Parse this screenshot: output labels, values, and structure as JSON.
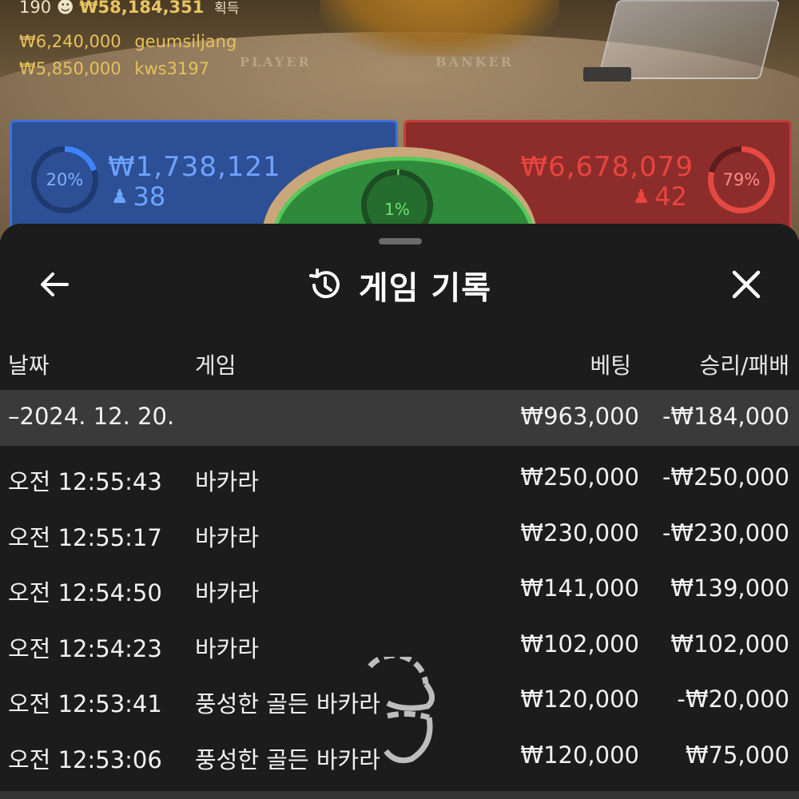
{
  "hud": {
    "top_count": "190",
    "top_amount": "₩58,184,351",
    "top_suffix": "획득",
    "winners": [
      {
        "amount": "₩6,240,000",
        "user": "geumsiljang"
      },
      {
        "amount": "₩5,850,000",
        "user": "kws3197"
      }
    ]
  },
  "table": {
    "player_label": "PLAYER",
    "banker_label": "BANKER"
  },
  "bets": {
    "player": {
      "percent": "20%",
      "amount": "₩1,738,121",
      "count": "38",
      "color": "#3e73d8"
    },
    "banker": {
      "percent": "79%",
      "amount": "₩6,678,079",
      "count": "42",
      "color": "#c3403a"
    },
    "tie": {
      "percent": "1%",
      "color": "#57c95c"
    }
  },
  "sheet": {
    "title": "게임 기록",
    "back_icon": "arrow-left-icon",
    "history_icon": "history-icon",
    "close_icon": "close-icon",
    "columns": {
      "date": "날짜",
      "game": "게임",
      "bet": "베팅",
      "result": "승리/패배"
    },
    "day": {
      "date": "–2024. 12. 20.",
      "bet": "₩963,000",
      "result": "-₩184,000"
    },
    "rows": [
      {
        "time": "오전 12:55:43",
        "game": "바카라",
        "bet": "₩250,000",
        "result": "-₩250,000"
      },
      {
        "time": "오전 12:55:17",
        "game": "바카라",
        "bet": "₩230,000",
        "result": "-₩230,000"
      },
      {
        "time": "오전 12:54:50",
        "game": "바카라",
        "bet": "₩141,000",
        "result": "₩139,000"
      },
      {
        "time": "오전 12:54:23",
        "game": "바카라",
        "bet": "₩102,000",
        "result": "₩102,000"
      },
      {
        "time": "오전 12:53:41",
        "game": "풍성한 골든 바카라",
        "bet": "₩120,000",
        "result": "-₩20,000"
      },
      {
        "time": "오전 12:53:06",
        "game": "풍성한 골든 바카라",
        "bet": "₩120,000",
        "result": "₩75,000"
      }
    ]
  }
}
